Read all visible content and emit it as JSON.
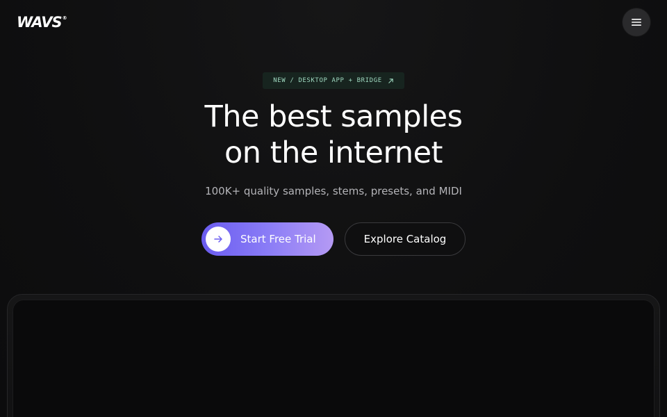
{
  "header": {
    "logo_text": "WAVS",
    "logo_mark": "®",
    "menu_icon": "hamburger-menu-icon"
  },
  "hero": {
    "badge": {
      "text": "NEW / DESKTOP APP + BRIDGE",
      "icon": "arrow-up-right-icon",
      "color": "#9fd9c0"
    },
    "headline_line1": "The best samples",
    "headline_line2": "on the internet",
    "subheadline": "100K+ quality samples, stems, presets, and MIDI",
    "primary_cta": {
      "label": "Start Free Trial",
      "icon": "arrow-right-icon"
    },
    "secondary_cta": {
      "label": "Explore Catalog"
    }
  },
  "colors": {
    "background": "#0f0f10",
    "accent_gradient_start": "#6a5cf0",
    "accent_gradient_end": "#b59af4",
    "badge_background": "#17241f"
  }
}
